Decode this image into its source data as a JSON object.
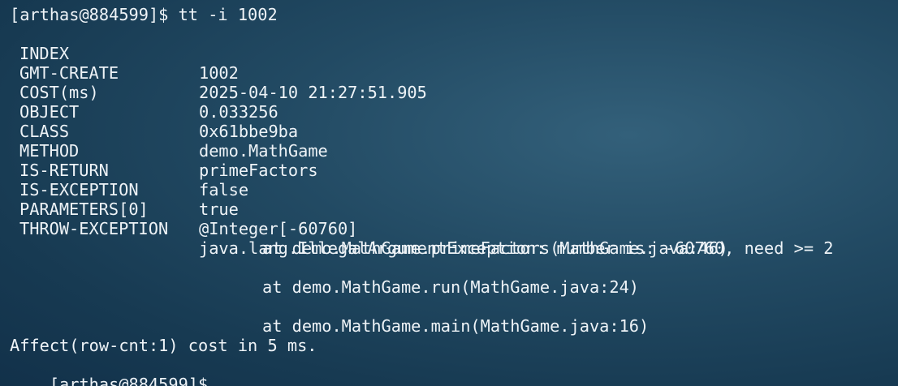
{
  "prompt_top": "[arthas@884599]$ tt -i 1002",
  "rows": [
    {
      "key": "INDEX",
      "value": "1002"
    },
    {
      "key": "GMT-CREATE",
      "value": "2025-04-10 21:27:51.905"
    },
    {
      "key": "COST(ms)",
      "value": "0.033256"
    },
    {
      "key": "OBJECT",
      "value": "0x61bbe9ba"
    },
    {
      "key": "CLASS",
      "value": "demo.MathGame"
    },
    {
      "key": "METHOD",
      "value": "primeFactors"
    },
    {
      "key": "IS-RETURN",
      "value": "false"
    },
    {
      "key": "IS-EXCEPTION",
      "value": "true"
    },
    {
      "key": "PARAMETERS[0]",
      "value": "@Integer[-60760]"
    },
    {
      "key": "THROW-EXCEPTION",
      "value": "java.lang.IllegalArgumentException: number is: -60760, need >= 2"
    }
  ],
  "stack": [
    "at demo.MathGame.primeFactors(MathGame.java:46)",
    "at demo.MathGame.run(MathGame.java:24)",
    "at demo.MathGame.main(MathGame.java:16)"
  ],
  "affect_line": "Affect(row-cnt:1) cost in 5 ms.",
  "prompt_bottom": "[arthas@884599]$"
}
